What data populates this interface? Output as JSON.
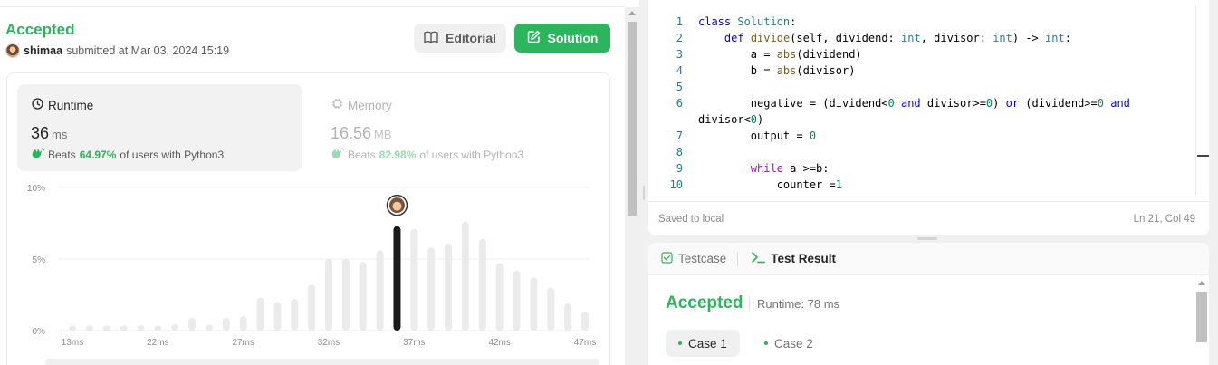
{
  "submission": {
    "status": "Accepted",
    "user": "shimaa",
    "submitted_text": "submitted at Mar 03, 2024 15:19",
    "editorial_label": "Editorial",
    "solution_label": "Solution"
  },
  "runtime": {
    "title": "Runtime",
    "value": "36",
    "unit": "ms",
    "beats_prefix": "Beats",
    "beats_pct": "64.97%",
    "beats_suffix": "of users with Python3"
  },
  "memory": {
    "title": "Memory",
    "value": "16.56",
    "unit": "MB",
    "beats_prefix": "Beats",
    "beats_pct": "82.98%",
    "beats_suffix": "of users with Python3"
  },
  "colors": {
    "accent_green": "#2db55d",
    "bar_default": "#ebebeb",
    "bar_highlight": "#1a1a1a"
  },
  "chart_data": {
    "type": "bar",
    "y_ticks": [
      "10%",
      "5%",
      "0%"
    ],
    "ylim": [
      0,
      10
    ],
    "x_tick_labels": [
      "13ms",
      "22ms",
      "27ms",
      "32ms",
      "37ms",
      "42ms",
      "47ms"
    ],
    "values": [
      0.35,
      0.35,
      0.35,
      0.35,
      0.35,
      0.35,
      0.45,
      0.9,
      0.4,
      0.9,
      1.0,
      2.3,
      2.0,
      2.2,
      3.2,
      5.0,
      5.0,
      4.8,
      5.6,
      7.3,
      7.1,
      5.8,
      6.1,
      7.6,
      6.4,
      4.7,
      4.2,
      3.7,
      3.0,
      1.9,
      1.3
    ],
    "highlight_index": 19,
    "grid": true
  },
  "code": {
    "lines": [
      {
        "n": "1",
        "html": "<span class=\"k\">class</span> <span class=\"cls\">Solution</span>:"
      },
      {
        "n": "2",
        "html": "    <span class=\"k\">def</span> <span class=\"fn\">divide</span>(self, dividend: <span class=\"cls\">int</span>, divisor: <span class=\"cls\">int</span>) -> <span class=\"cls\">int</span>:"
      },
      {
        "n": "3",
        "html": "        a = <span class=\"fn\">abs</span>(dividend)"
      },
      {
        "n": "4",
        "html": "        b = <span class=\"fn\">abs</span>(divisor)"
      },
      {
        "n": "5",
        "html": ""
      },
      {
        "n": "6",
        "html": "        negative = (dividend&lt;<span class=\"num\">0</span> <span class=\"k\">and</span> divisor&gt;=<span class=\"num\">0</span>) <span class=\"k\">or</span> (dividend&gt;=<span class=\"num\">0</span> <span class=\"k\">and</span>"
      },
      {
        "n": "",
        "html": "divisor&lt;<span class=\"num\">0</span>)",
        "wrap": true
      },
      {
        "n": "7",
        "html": "        output = <span class=\"num\">0</span>"
      },
      {
        "n": "8",
        "html": ""
      },
      {
        "n": "9",
        "html": "        <span class=\"kf\">while</span> a &gt;=b:"
      },
      {
        "n": "10",
        "html": "            counter =<span class=\"num\">1</span>"
      }
    ],
    "saved_text": "Saved to local",
    "cursor_text": "Ln 21, Col 49"
  },
  "result": {
    "tab_testcase": "Testcase",
    "tab_result": "Test Result",
    "status": "Accepted",
    "runtime_text": "Runtime: 78 ms",
    "case1": "Case 1",
    "case2": "Case 2"
  }
}
